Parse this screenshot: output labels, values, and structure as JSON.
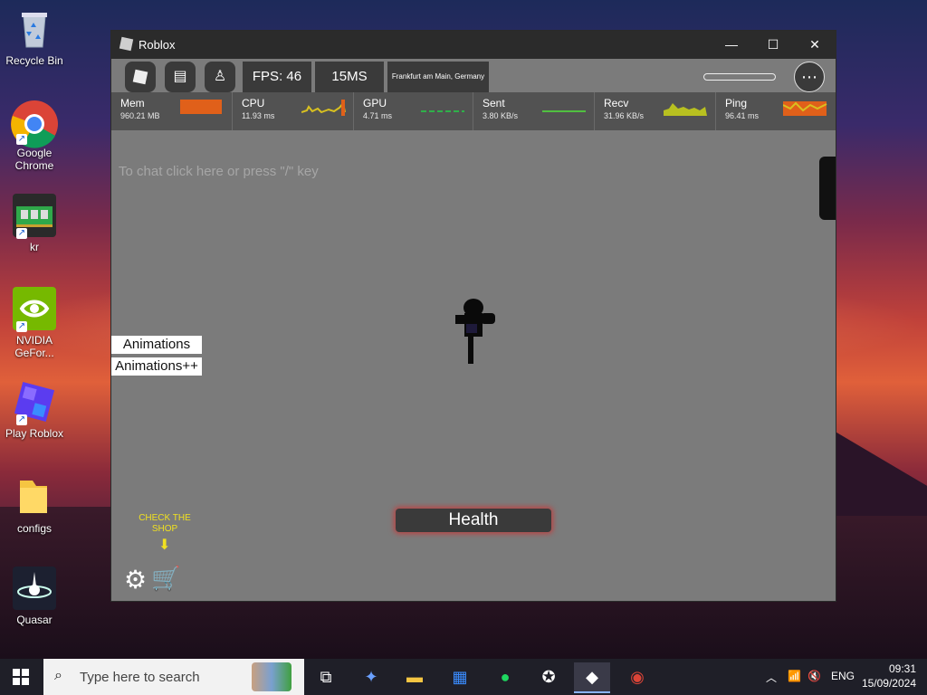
{
  "desktop": {
    "icons": [
      {
        "label": "Recycle Bin"
      },
      {
        "label": "Google Chrome"
      },
      {
        "label": "kr"
      },
      {
        "label": "NVIDIA GeFor..."
      },
      {
        "label": "Play Roblox"
      },
      {
        "label": "configs"
      },
      {
        "label": "Quasar"
      }
    ]
  },
  "window": {
    "title": "Roblox",
    "controls": {
      "minimize": "—",
      "maximize": "☐",
      "close": "✕"
    }
  },
  "topbar": {
    "fps": "FPS: 46",
    "latency": "15MS",
    "server_location": "Frankfurt am Main, Germany"
  },
  "stats": [
    {
      "label": "Mem",
      "value": "960.21 MB"
    },
    {
      "label": "CPU",
      "value": "11.93 ms"
    },
    {
      "label": "GPU",
      "value": "4.71 ms"
    },
    {
      "label": "Sent",
      "value": "3.80 KB/s"
    },
    {
      "label": "Recv",
      "value": "31.96 KB/s"
    },
    {
      "label": "Ping",
      "value": "96.41 ms"
    }
  ],
  "chat_hint": "To chat click here or press \"/\" key",
  "buttons": {
    "animations": "Animations",
    "animations_plus": "Animations++"
  },
  "health_label": "Health",
  "shop_hint": "CHECK THE SHOP",
  "taskbar": {
    "search_placeholder": "Type here to search",
    "language": "ENG",
    "time": "09:31",
    "date": "15/09/2024"
  },
  "colors": {
    "window_bg": "#7b7b7b",
    "stat_bar": "#525252",
    "shop_hint": "#f0e020",
    "health_glow": "#b44444"
  }
}
